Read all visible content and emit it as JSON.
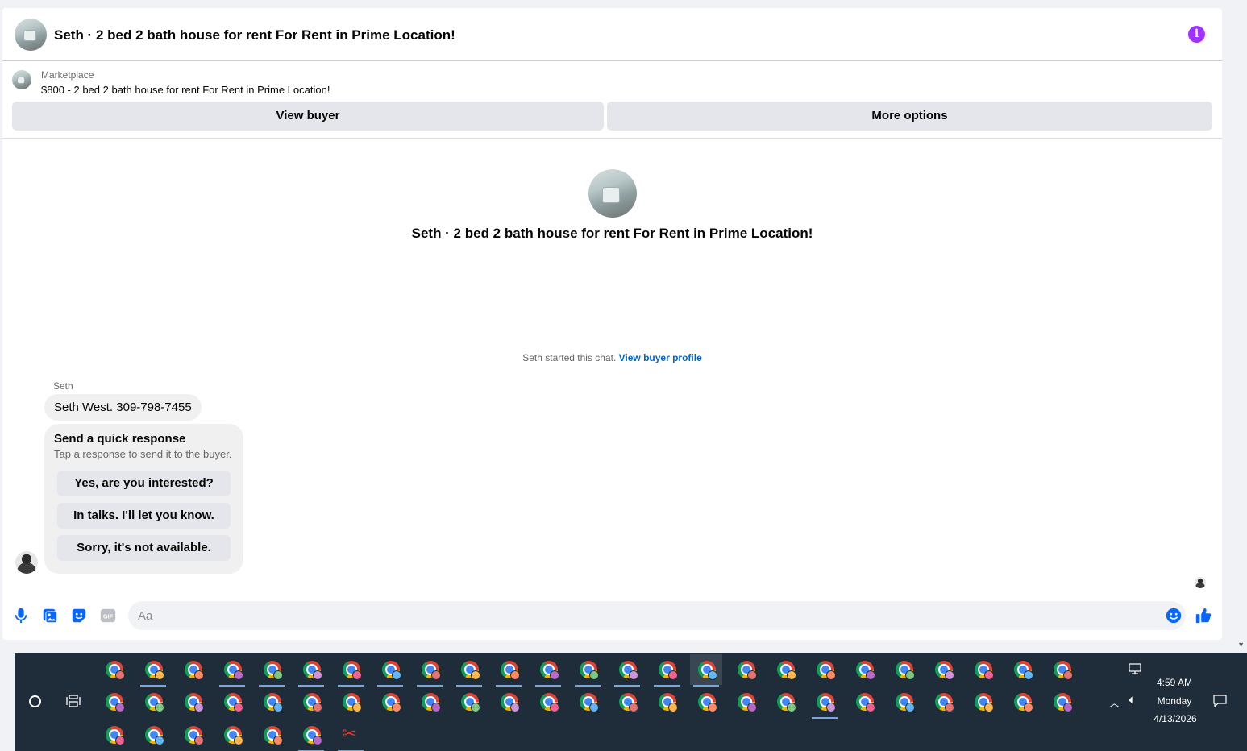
{
  "header": {
    "title": "Seth · 2 bed 2 bath house for rent For Rent in Prime Location!",
    "info_icon": "info-icon",
    "accent_color": "#a033ff"
  },
  "listing": {
    "label": "Marketplace",
    "title": "$800 - 2 bed 2 bath house for rent For Rent in Prime Location!",
    "view_buyer_label": "View buyer",
    "more_options_label": "More options"
  },
  "conversation": {
    "title": "Seth · 2 bed 2 bath house for rent For Rent in Prime Location!",
    "started_text": "Seth started this chat.",
    "view_profile_link": "View buyer profile",
    "sender_name": "Seth",
    "message_text": "Seth West. 309-798-7455",
    "quick_response": {
      "title": "Send a quick response",
      "subtitle": "Tap a response to send it to the buyer.",
      "options": [
        "Yes, are you interested?",
        "In talks. I'll let you know.",
        "Sorry, it's not available."
      ]
    }
  },
  "composer": {
    "placeholder": "Aa",
    "icons": [
      "microphone-icon",
      "image-icon",
      "sticker-icon",
      "gif-icon",
      "emoji-icon",
      "thumbs-up-icon"
    ],
    "gif_label": "GIF",
    "brand_color": "#0866ff"
  },
  "taskbar": {
    "time": "4:59 AM",
    "day": "Monday",
    "date": "4/13/2026",
    "background_color": "#1f2d3a",
    "app_icons": [
      "chrome-icon",
      "snipping-tool-icon"
    ]
  }
}
